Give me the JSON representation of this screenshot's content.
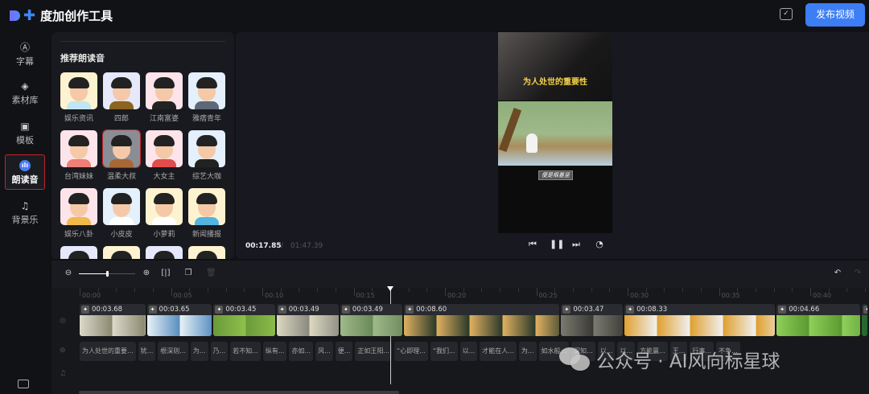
{
  "app": {
    "title": "度加创作工具",
    "publish_label": "发布视频"
  },
  "sidebar": {
    "items": [
      {
        "label": "字幕",
        "icon": "subtitle-a-icon",
        "glyph": "Ⓐ"
      },
      {
        "label": "素材库",
        "icon": "layers-icon",
        "glyph": "◈"
      },
      {
        "label": "模板",
        "icon": "template-icon",
        "glyph": "▣"
      },
      {
        "label": "朗读音",
        "icon": "voice-icon",
        "glyph": "ılı",
        "active": true
      },
      {
        "label": "背景乐",
        "icon": "music-note-icon",
        "glyph": "♫"
      }
    ]
  },
  "voice_panel": {
    "title": "推荐朗读音",
    "voices": [
      {
        "label": "娱乐资讯",
        "bg": "#fdf3d0",
        "body": "#bfe6f2"
      },
      {
        "label": "四郎",
        "bg": "#e6e8fb",
        "body": "#8a6420"
      },
      {
        "label": "江南富婆",
        "bg": "#fde4ea",
        "body": "#222"
      },
      {
        "label": "雅痞青年",
        "bg": "#e4f0fb",
        "body": "#5d6878"
      },
      {
        "label": "台湾妹妹",
        "bg": "#fde4ea",
        "body": "#ef7f77"
      },
      {
        "label": "温柔大叔",
        "bg": "#8b8d94",
        "body": "#a76736",
        "selected": true
      },
      {
        "label": "大女主",
        "bg": "#fde4ea",
        "body": "#e04d4d"
      },
      {
        "label": "综艺大咖",
        "bg": "#e4f0fb",
        "body": "#222"
      },
      {
        "label": "娱乐八卦",
        "bg": "#fde4ea",
        "body": "#f2b94a"
      },
      {
        "label": "小皮皮",
        "bg": "#e4f0fb",
        "body": "#fff"
      },
      {
        "label": "小萝莉",
        "bg": "#fdf3d0",
        "body": "#fff"
      },
      {
        "label": "新闻播报",
        "bg": "#fdf3d0",
        "body": "#53b4e0"
      },
      {
        "label": "",
        "bg": "#e6e8fb",
        "body": "#333"
      },
      {
        "label": "",
        "bg": "#fdf3d0",
        "body": "#333"
      },
      {
        "label": "",
        "bg": "#e6e8fb",
        "body": "#333"
      },
      {
        "label": "",
        "bg": "#fdf3d0",
        "body": "#333"
      }
    ]
  },
  "preview": {
    "video_title": "为人处世的重要性",
    "video_caption": "便是根基坚",
    "current_time": "00:17.85",
    "separator": "/",
    "total_time": "01:47.39"
  },
  "timeline": {
    "ruler_labels": [
      "00:00",
      "00:05",
      "00:10",
      "00:15",
      "00:20",
      "00:25",
      "00:30",
      "00:35",
      "00:40"
    ],
    "zoom_level": 0.5,
    "clips": [
      {
        "duration": "00:03.68",
        "colors": [
          "#dcd9cc",
          "#8a8a70"
        ]
      },
      {
        "duration": "00:03.65",
        "colors": [
          "#e8f2f8",
          "#5a8fbf"
        ]
      },
      {
        "duration": "00:03.45",
        "colors": [
          "#6a9a3a",
          "#8fbf4a"
        ]
      },
      {
        "duration": "00:03.49",
        "colors": [
          "#dcd8c0",
          "#8a8a80"
        ]
      },
      {
        "duration": "00:03.49",
        "colors": [
          "#9fb98a",
          "#6a8a5a"
        ]
      },
      {
        "duration": "00:08.60",
        "colors": [
          "#e0b060",
          "#2a3a2a"
        ]
      },
      {
        "duration": "00:03.47",
        "colors": [
          "#7a7a70",
          "#3a3a35"
        ]
      },
      {
        "duration": "00:08.33",
        "colors": [
          "#e0a030",
          "#f0f0f0"
        ]
      },
      {
        "duration": "00:04.66",
        "colors": [
          "#8fcf5a",
          "#5a9a30"
        ]
      },
      {
        "duration": "",
        "colors": [
          "#2a6a30",
          "#1a4a20"
        ]
      }
    ],
    "subtitles": [
      "为人处世的重要...",
      "犹...",
      "根深则...",
      "为...",
      "乃...",
      "若不知...",
      "纵有...",
      "亦如...",
      "风...",
      "便...",
      "正如王阳...",
      "“心即理...",
      "“我们...",
      "以...",
      "才能在人...",
      "为...",
      "如水般...",
      "深知...",
      "以...",
      "以...",
      "方能赢...",
      "王...",
      "行事...",
      "不争..."
    ]
  },
  "watermark": "公众号 · AI风向标星球"
}
